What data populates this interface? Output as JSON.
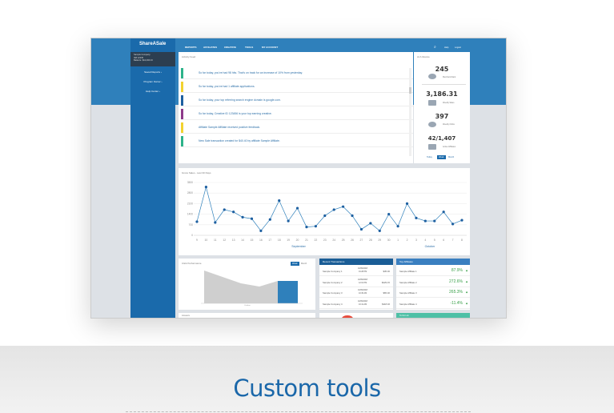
{
  "section_heading": "Custom tools",
  "dashboard": {
    "logo": "ShareASale",
    "account": {
      "name": "Sample Company",
      "id": "ID# 12345",
      "balance": "Balance: $12,490.16"
    },
    "sidebar": [
      {
        "label": "Saved Reports ›"
      },
      {
        "label": "Program Owner ›"
      },
      {
        "label": "Help Center ›"
      }
    ],
    "nav": [
      "REPORTS",
      "AFFILIATES",
      "CREATIVE",
      "TOOLS",
      "MY ACCOUNT"
    ],
    "header_links": {
      "help": "Help",
      "logout": "Logout",
      "search_icon": "search-icon"
    },
    "activity": {
      "title": "Activity Feed",
      "items": [
        {
          "text": "So far today, you've had 98 hits. That's on track for an increase of 10% from yesterday.",
          "color": "#2db38a"
        },
        {
          "text": "So far today, you've had 1 affiliate applications.",
          "color": "#f2d230"
        },
        {
          "text": "So far today, your top referring search engine domain is google.com.",
          "color": "#1d5fa0"
        },
        {
          "text": "So far today, Creative ID 123456 is your top earning creative.",
          "color": "#8e3a8a"
        },
        {
          "text": "Affiliate Sample Affiliate received positive feedback.",
          "color": "#f2d230"
        },
        {
          "text": "New Sale transaction created for $40.40 by affiliate Sample Affiliate.",
          "color": "#2db38a"
        }
      ]
    },
    "glance": {
      "title": "At A Glance",
      "stats": [
        {
          "value": "245",
          "label": "Merchant Rank"
        },
        {
          "value": "3,186.31",
          "label": "Weekly Sales"
        },
        {
          "value": "397",
          "label": "Weekly Clicks"
        },
        {
          "value": "42/1,407",
          "label": "Active Affiliates"
        }
      ],
      "periods": [
        "Today",
        "Week",
        "Month"
      ],
      "selected_period": "Week"
    },
    "click_perf": {
      "title": "Click Performance",
      "toggles": [
        "Week",
        "Month"
      ],
      "selected": "Week",
      "xlabel": "October"
    },
    "transactions": {
      "title": "Recent Transactions",
      "rows": [
        {
          "company": "Sample Company 1",
          "date": "10/09/2018",
          "time": "01:28 PM",
          "amount": "$45.46"
        },
        {
          "company": "Sample Company 2",
          "date": "10/09/2018",
          "time": "12:01 PM",
          "amount": "$429.15"
        },
        {
          "company": "Sample Company 3",
          "date": "10/09/2018",
          "time": "10:30 AM",
          "amount": "$65.40"
        },
        {
          "company": "Sample Company 4",
          "date": "10/09/2018",
          "time": "10:41 AM",
          "amount": "$118.40"
        }
      ]
    },
    "top_affiliates": {
      "title": "Top Affiliates",
      "rows": [
        {
          "name": "Sample Affiliate 1",
          "pct": "87.9%"
        },
        {
          "name": "Sample Affiliate 2",
          "pct": "272.6%"
        },
        {
          "name": "Sample Affiliate 3",
          "pct": "265.3%"
        },
        {
          "name": "Sample Affiliate 4",
          "pct": "-11.4%"
        }
      ]
    },
    "bottom_panels": {
      "left": "Answers",
      "right": "To Do List"
    },
    "accent": "#1a6aab"
  },
  "chart_data": {
    "type": "line",
    "title": "Gross Sales - Last 30 Days",
    "x": [
      "9",
      "10",
      "11",
      "12",
      "13",
      "14",
      "15",
      "16",
      "17",
      "18",
      "19",
      "20",
      "21",
      "22",
      "23",
      "24",
      "25",
      "26",
      "27",
      "28",
      "29",
      "30",
      "1",
      "2",
      "3",
      "4",
      "5",
      "6",
      "7",
      "8"
    ],
    "month_labels": [
      "September",
      "October"
    ],
    "values": [
      900,
      3200,
      850,
      1700,
      1550,
      1200,
      1100,
      300,
      1050,
      2300,
      950,
      1800,
      550,
      600,
      1300,
      1700,
      1900,
      1300,
      400,
      800,
      300,
      1400,
      600,
      2100,
      1150,
      950,
      950,
      1550,
      750,
      1000
    ],
    "yticks": [
      0,
      700,
      1400,
      2100,
      2800,
      3500
    ],
    "ylim": [
      0,
      3500
    ],
    "grid": true,
    "color": "#2f80bb"
  }
}
